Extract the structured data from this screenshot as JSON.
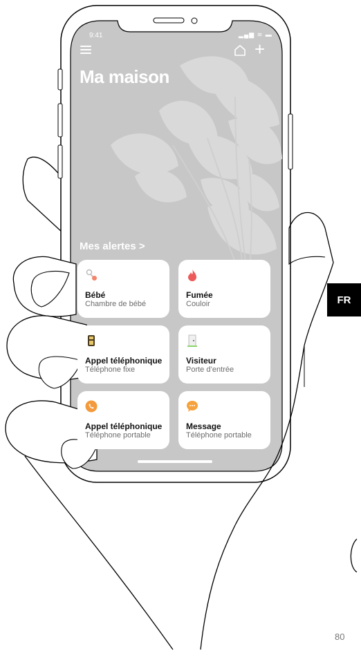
{
  "status_bar": {
    "time": "9:41",
    "icons_text": "▂▄▆ ≋ ▬"
  },
  "header": {
    "title": "Ma maison",
    "menu_icon": "hamburger-icon",
    "home_icon": "home-icon",
    "add_label": "+"
  },
  "alerts": {
    "link_label": "Mes alertes >",
    "cards": [
      {
        "title": "Bébé",
        "subtitle": "Chambre de bébé",
        "icon": "baby-rattle-icon"
      },
      {
        "title": "Fumée",
        "subtitle": "Couloir",
        "icon": "flame-icon"
      },
      {
        "title": "Appel téléphonique",
        "subtitle": "Téléphone fixe",
        "icon": "landline-phone-icon"
      },
      {
        "title": "Visiteur",
        "subtitle": "Porte d’entrée",
        "icon": "door-icon"
      },
      {
        "title": "Appel téléphonique",
        "subtitle": "Téléphone portable",
        "icon": "mobile-call-icon"
      },
      {
        "title": "Message",
        "subtitle": "Téléphone portable",
        "icon": "message-bubble-icon"
      }
    ]
  },
  "page": {
    "language_tab": "FR",
    "page_number": "80"
  },
  "colors": {
    "screen_bg": "#c7c7c7",
    "plant": "#dadada",
    "flame": "#ec5a5a",
    "call_orange": "#f39a3c",
    "message_orange": "#f6a23c"
  }
}
